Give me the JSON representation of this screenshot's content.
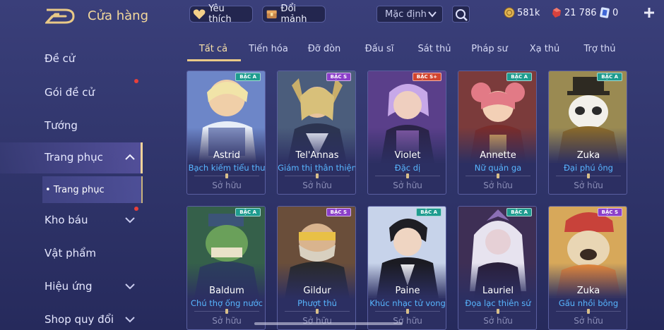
{
  "header": {
    "title": "Cửa hàng",
    "back_icon": "back-arrow-icon",
    "favorite_label": "Yêu thích",
    "fragment_label": "Đổi mảnh",
    "sort": {
      "selected": "Mặc định"
    },
    "currencies": {
      "coin": "581k",
      "gem": "21 786",
      "ticket": "0"
    }
  },
  "sidebar": {
    "items": [
      {
        "label": "Đề cử",
        "has_dot": false,
        "chevron": false
      },
      {
        "label": "Gói đề cử",
        "has_dot": true,
        "chevron": false
      },
      {
        "label": "Tướng",
        "has_dot": false,
        "chevron": false
      },
      {
        "label": "Trang phục",
        "has_dot": false,
        "chevron": "up"
      },
      {
        "label": "Kho báu",
        "has_dot": true,
        "chevron": "down"
      },
      {
        "label": "Vật phẩm",
        "has_dot": false,
        "chevron": false
      },
      {
        "label": "Hiệu ứng",
        "has_dot": false,
        "chevron": "down"
      },
      {
        "label": "Shop quy đổi",
        "has_dot": false,
        "chevron": "down"
      }
    ],
    "subitem": "• Trang phục"
  },
  "tabs": [
    "Tất cả",
    "Tiến hóa",
    "Đỡ đòn",
    "Đấu sĩ",
    "Sát thủ",
    "Pháp sư",
    "Xạ thủ",
    "Trợ thủ"
  ],
  "active_tab": 0,
  "colors": {
    "accent_gold": "#f0d39a",
    "skin_name_blue": "#58b6ff",
    "badge_a": "#1f9c8f",
    "badge_s": "#8b3fc9",
    "badge_splus": "#d2452f"
  },
  "cards": [
    {
      "hero": "Astrid",
      "skin": "Bạch kiếm tiểu thư",
      "tier": "BẬC A",
      "status": "Sở hữu"
    },
    {
      "hero": "Tel'Annas",
      "skin": "Giám thị thân thiện",
      "tier": "BẬC S",
      "status": "Sở hữu"
    },
    {
      "hero": "Violet",
      "skin": "Đặc dị",
      "tier": "BẬC S+",
      "status": "Sở hữu"
    },
    {
      "hero": "Annette",
      "skin": "Nữ quản ga",
      "tier": "BẬC A",
      "status": "Sở hữu"
    },
    {
      "hero": "Zuka",
      "skin": "Đại phú ông",
      "tier": "BẬC A",
      "status": "Sở hữu"
    },
    {
      "hero": "Baldum",
      "skin": "Chú thợ ống nước",
      "tier": "BẬC A",
      "status": "Sở hữu"
    },
    {
      "hero": "Gildur",
      "skin": "Phượt thủ",
      "tier": "BẬC S",
      "status": "Sở hữu"
    },
    {
      "hero": "Paine",
      "skin": "Khúc nhạc tử vong",
      "tier": "BẬC A",
      "status": "Sở hữu"
    },
    {
      "hero": "Lauriel",
      "skin": "Đọa lạc thiên sứ",
      "tier": "BẬC A",
      "status": "Sở hữu"
    },
    {
      "hero": "Zuka",
      "skin": "Gấu nhồi bông",
      "tier": "BẬC S",
      "status": "Sở hữu"
    }
  ]
}
